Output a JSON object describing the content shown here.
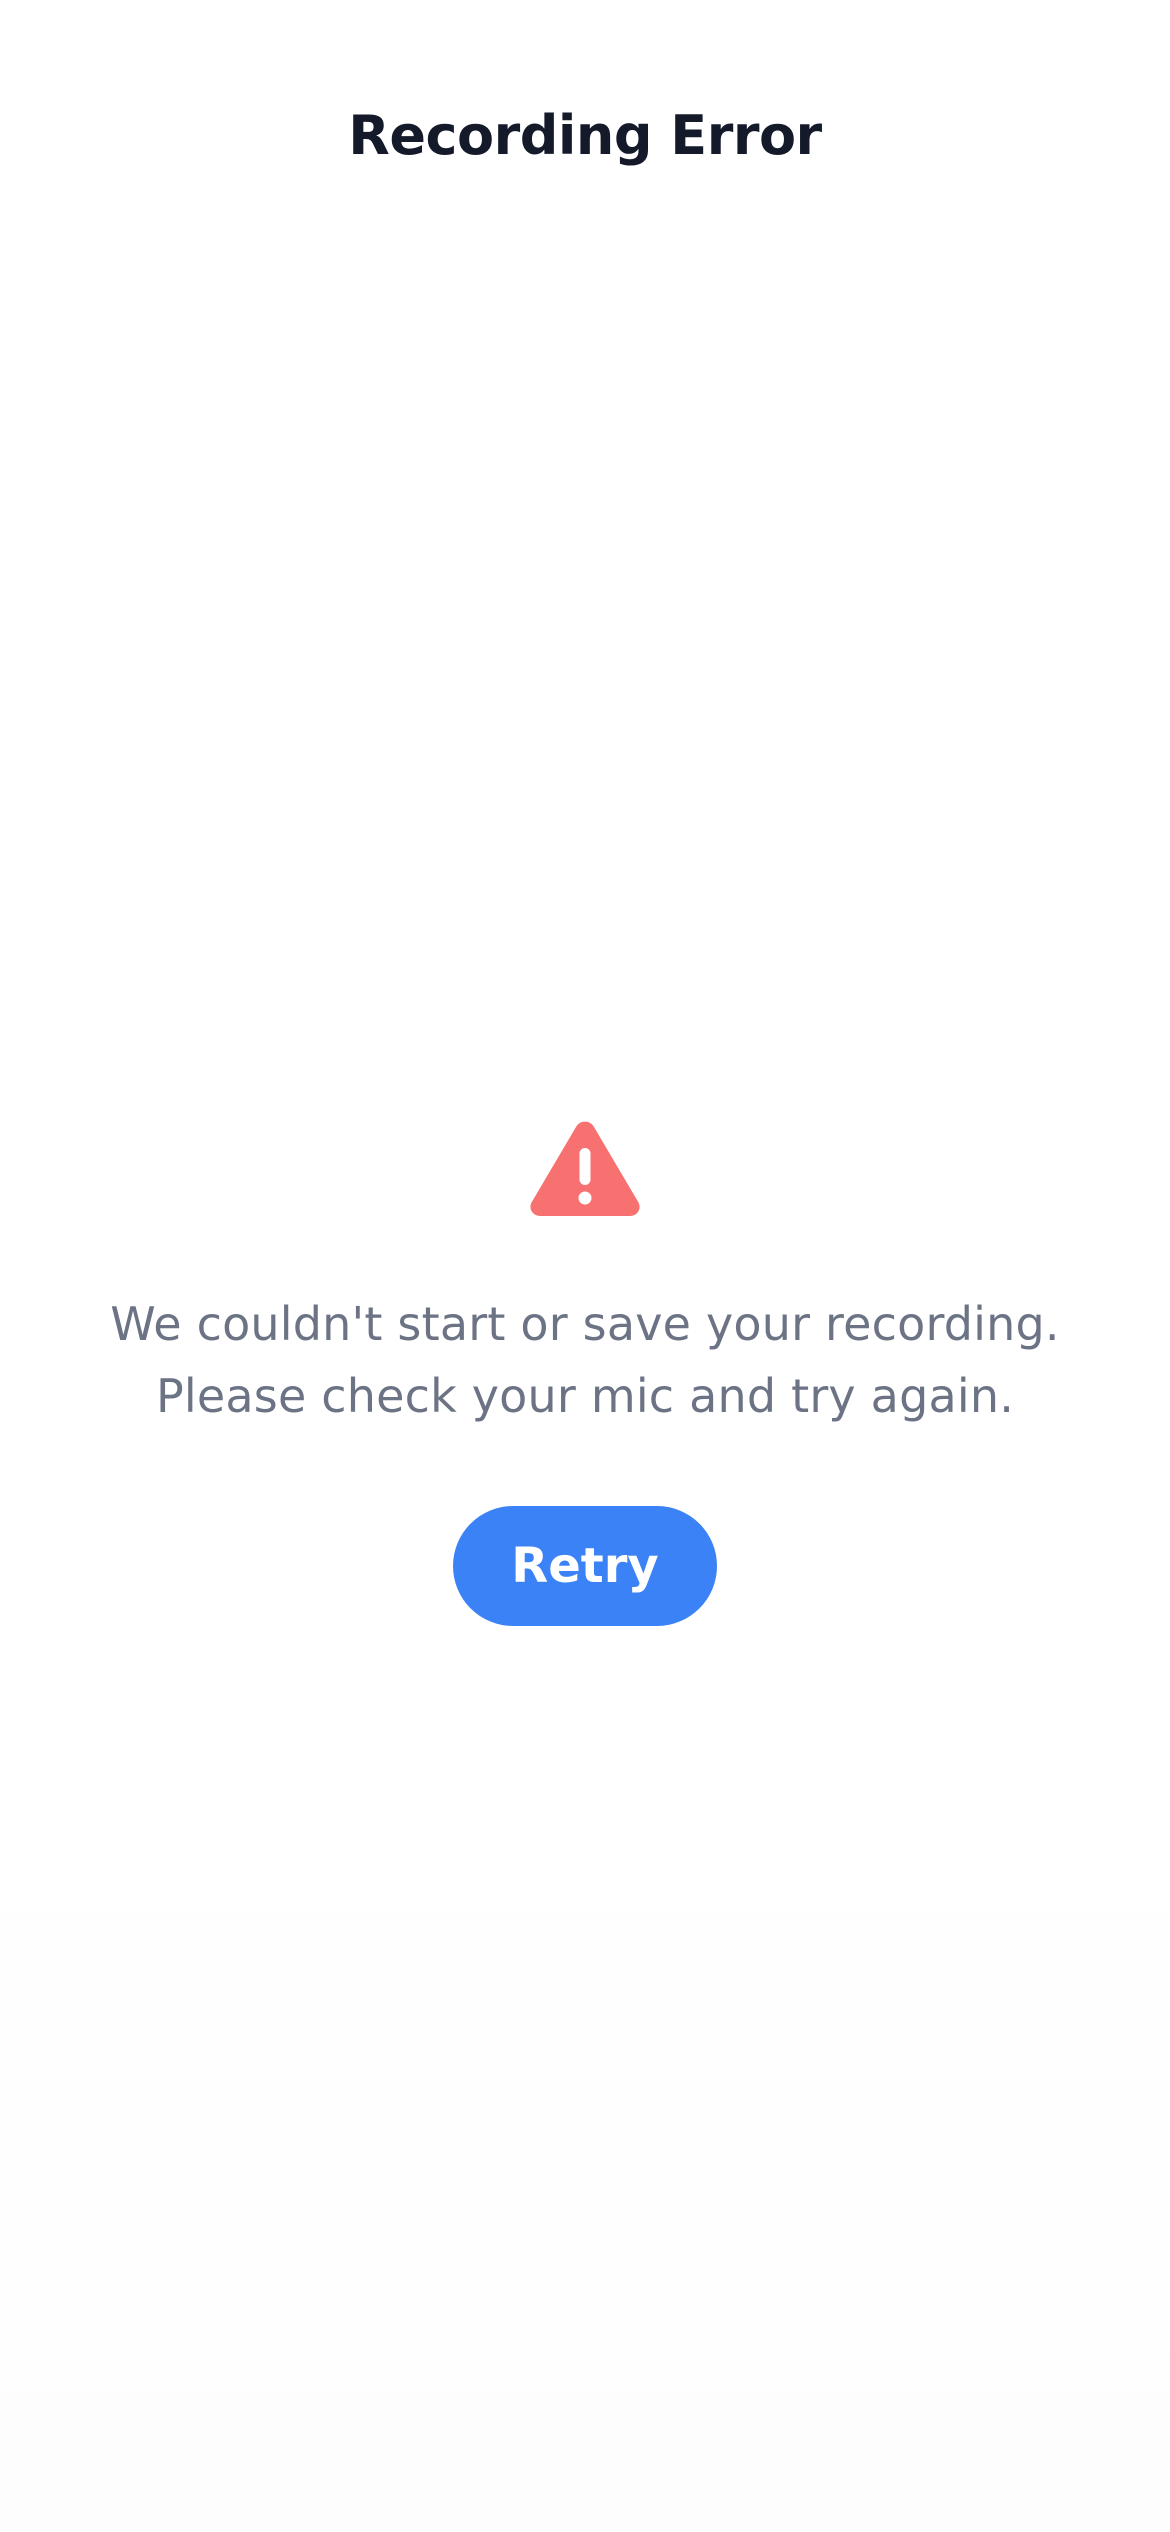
{
  "header": {
    "title": "Recording Error"
  },
  "error": {
    "icon": "warning-triangle-icon",
    "icon_color": "#f87171",
    "message_line1": "We couldn't start or save your recording.",
    "message_line2": "Please check your mic and try again."
  },
  "actions": {
    "retry_label": "Retry",
    "retry_color": "#3b82f6"
  }
}
